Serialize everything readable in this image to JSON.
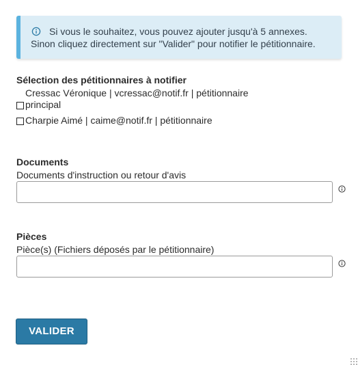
{
  "info": {
    "line1": "Si vous le souhaitez, vous pouvez ajouter jusqu'à 5 annexes.",
    "line2": "Sinon cliquez directement sur \"Valider\" pour notifier le pétitionnaire.",
    "icon": "info-circle-icon"
  },
  "petitioners": {
    "title": "Sélection des pétitionnaires à notifier",
    "items": [
      {
        "label": "Cressac Véronique | vcressac@notif.fr | pétitionnaire"
      },
      {
        "label": "principal",
        "checked": false
      },
      {
        "label": "Charpie Aimé | caime@notif.fr | pétitionnaire",
        "checked": false
      }
    ]
  },
  "documents": {
    "title": "Documents",
    "field_label": "Documents d'instruction ou retour d'avis",
    "value": "",
    "help_icon": "info-circle-icon"
  },
  "pieces": {
    "title": "Pièces",
    "field_label": "Pièce(s) (Fichiers déposés par le pétitionnaire)",
    "value": "",
    "help_icon": "info-circle-icon"
  },
  "submit": {
    "label": "VALIDER"
  },
  "colors": {
    "accent": "#2b7aa5",
    "info_bg": "#dcedf6",
    "info_border": "#5bb3df"
  }
}
